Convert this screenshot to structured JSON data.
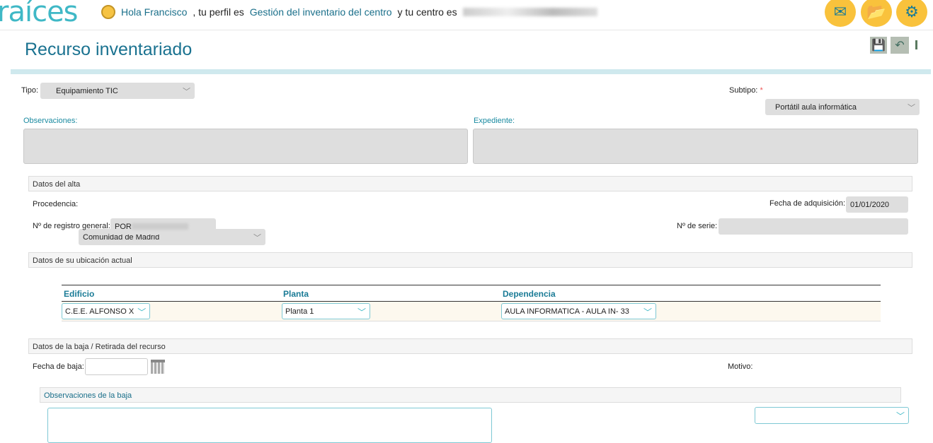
{
  "header": {
    "logo": "raíces",
    "greeting": "Hola Francisco",
    "profile_text": ", tu perfil es",
    "profile": "Gestión del inventario del centro",
    "center_text": "y tu centro es"
  },
  "page": {
    "title": "Recurso inventariado"
  },
  "form": {
    "tipo_label": "Tipo:",
    "tipo_value": "Equipamiento TIC",
    "subtipo_label": "Subtipo:",
    "subtipo_required": "*",
    "subtipo_value": "Portátil aula informática",
    "observaciones_label": "Observaciones:",
    "expediente_label": "Expediente:",
    "alta": {
      "title": "Datos del alta",
      "procedencia_label": "Procedencia:",
      "procedencia_value": "Comunidad de Madrid",
      "fecha_label": "Fecha de adquisición:",
      "fecha_value": "01/01/2020",
      "registro_label": "Nº de registro general:",
      "registro_value": "POR",
      "serie_label": "Nº de serie:",
      "serie_value": ""
    },
    "ubicacion": {
      "title": "Datos de su ubicación actual",
      "columns": [
        "Edificio",
        "Planta",
        "Dependencia"
      ],
      "row": [
        "C.E.E. ALFONSO X",
        "Planta 1",
        "AULA INFORMATICA - AULA IN- 33"
      ]
    },
    "baja": {
      "title": "Datos de la baja / Retirada del recurso",
      "fecha_label": "Fecha de baja:",
      "fecha_value": "",
      "motivo_label": "Motivo:",
      "motivo_value": "",
      "obs_title": "Observaciones de la baja"
    }
  }
}
